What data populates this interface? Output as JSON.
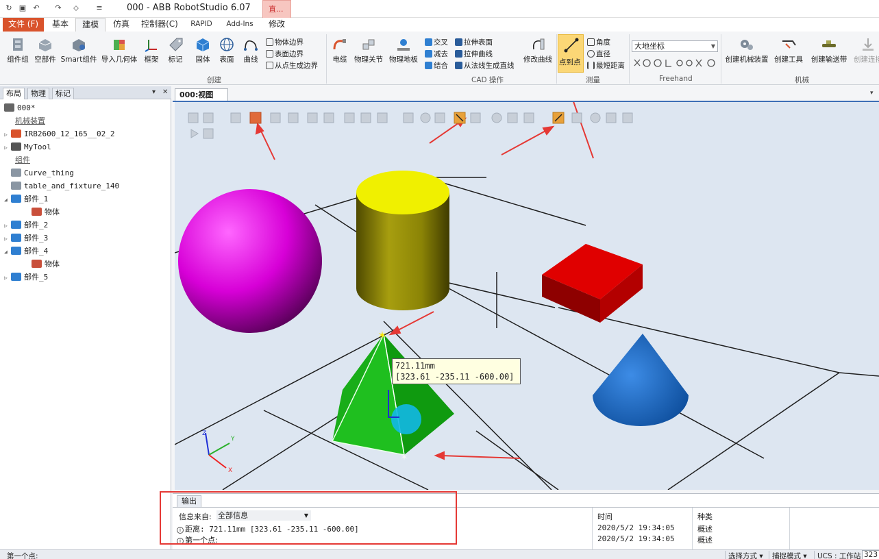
{
  "window": {
    "title": "000 - ABB RobotStudio 6.07",
    "context_group": "直...",
    "quick_access": [
      "refresh-icon",
      "save-icon",
      "undo-icon",
      "redo-icon",
      "customize-icon"
    ]
  },
  "tabs": [
    {
      "label": "文件 (F)"
    },
    {
      "label": "基本"
    },
    {
      "label": "建模"
    },
    {
      "label": "仿真"
    },
    {
      "label": "控制器(C)"
    },
    {
      "label": "RAPID"
    },
    {
      "label": "Add-Ins"
    },
    {
      "label": "修改"
    }
  ],
  "ribbon": {
    "create": {
      "label": "创建",
      "buttons": [
        "组件组",
        "空部件",
        "Smart组件",
        "导入几何体",
        "框架",
        "标记",
        "固体",
        "表面",
        "曲线"
      ],
      "small": [
        "物体边界",
        "表面边界",
        "从点生成边界"
      ]
    },
    "cad": {
      "label": "CAD 操作",
      "buttons": [
        "电缆",
        "物理关节",
        "物理地板"
      ],
      "small": [
        "交叉",
        "减去",
        "结合",
        "拉伸表面",
        "拉伸曲线",
        "从法线生成直线"
      ],
      "modify_curve": "修改曲线"
    },
    "measure": {
      "label": "测量",
      "active": "点到点",
      "small": [
        "角度",
        "直径",
        "最短距离"
      ]
    },
    "freehand": {
      "label": "Freehand",
      "coord_value": "大地坐标"
    },
    "mechanism": {
      "label": "机械",
      "buttons": [
        "创建机械装置",
        "创建工具",
        "创建输送带",
        "创建连接"
      ]
    }
  },
  "left_panel": {
    "tabs": [
      "布局",
      "物理",
      "标记"
    ],
    "tree": [
      {
        "label": "000*",
        "kind": "root",
        "icon": "station-icon"
      },
      {
        "label": "机械装置",
        "kind": "header"
      },
      {
        "label": "IRB2600_12_165__02_2",
        "kind": "item",
        "icon": "robot-icon",
        "expand": "▷"
      },
      {
        "label": "MyTool",
        "kind": "item",
        "icon": "tool-icon",
        "expand": "▷"
      },
      {
        "label": "组件",
        "kind": "header"
      },
      {
        "label": "Curve_thing",
        "kind": "item",
        "icon": "component-icon"
      },
      {
        "label": "table_and_fixture_140",
        "kind": "item",
        "icon": "component-icon"
      },
      {
        "label": "部件_1",
        "kind": "item",
        "icon": "part-icon",
        "expand": "◢"
      },
      {
        "label": "物体",
        "kind": "child",
        "icon": "body-icon"
      },
      {
        "label": "部件_2",
        "kind": "item",
        "icon": "part-icon",
        "expand": "▷"
      },
      {
        "label": "部件_3",
        "kind": "item",
        "icon": "part-icon",
        "expand": "▷"
      },
      {
        "label": "部件_4",
        "kind": "item",
        "icon": "part-icon",
        "expand": "◢"
      },
      {
        "label": "物体",
        "kind": "child",
        "icon": "body-icon"
      },
      {
        "label": "部件_5",
        "kind": "item",
        "icon": "part-icon",
        "expand": "▷"
      }
    ]
  },
  "view": {
    "tab_label": "000:视图1",
    "tab_close": "×",
    "tooltip_distance": "721.11mm",
    "tooltip_coords": "[323.61 -235.11 -600.00]",
    "axes": {
      "x": "X",
      "y": "Y",
      "z": "Z"
    }
  },
  "output": {
    "tab_label": "输出",
    "source_label": "信息来自:",
    "source_value": "全部信息",
    "columns": {
      "time": "时间",
      "kind": "种类"
    },
    "rows": [
      {
        "message": "距离:  721.11mm [323.61 -235.11 -600.00]",
        "time": "2020/5/2 19:34:05",
        "kind": "概述"
      },
      {
        "message": "第一个点:",
        "time": "2020/5/2 19:34:05",
        "kind": "概述"
      }
    ]
  },
  "status": {
    "left": "第一个点:",
    "select_mode": "选择方式",
    "snap_mode": "捕捉模式",
    "ucs": "UCS : 工作站",
    "coord_partial": "323"
  },
  "colors": {
    "file_tab": "#d9532c",
    "accent_blue": "#3d6fb6",
    "annotation_red": "#e53935",
    "highlight": "#fbd776"
  }
}
